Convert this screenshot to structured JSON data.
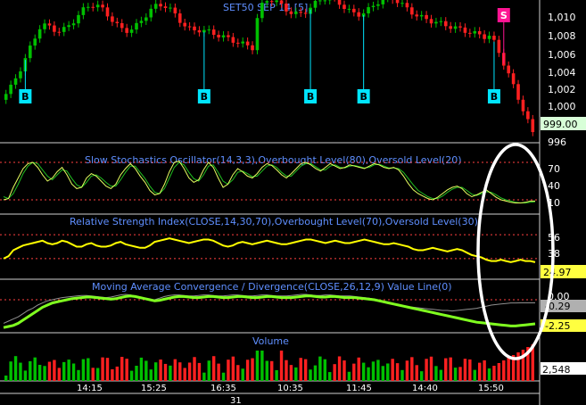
{
  "chart_data": [
    {
      "type": "candlestick",
      "title": "SET50 SEP 14 [5]",
      "y_ticks": [
        "1,010",
        "1,008",
        "1,006",
        "1,004",
        "1,002",
        "1,000"
      ],
      "ylim": [
        999,
        1011
      ],
      "current_value": "999.00",
      "bottom_label": "996",
      "signals": [
        {
          "type": "B",
          "x_index": 4
        },
        {
          "type": "B",
          "x_index": 41
        },
        {
          "type": "B",
          "x_index": 63
        },
        {
          "type": "B",
          "x_index": 74
        },
        {
          "type": "B",
          "x_index": 101
        },
        {
          "type": "S",
          "x_index": 103
        }
      ],
      "colors": {
        "up": "#00c000",
        "down": "#ff2020",
        "buy": "#00e5ff",
        "sell": "#ff1493"
      }
    },
    {
      "type": "line",
      "title": "Slow Stochastics Oscillator(14,3,3),Overbought Level(80),Oversold Level(20)",
      "y_ticks": [
        "70",
        "40",
        "10"
      ],
      "ylim": [
        0,
        100
      ],
      "levels": [
        80,
        20
      ],
      "series": [
        {
          "color": "#e8ff60",
          "values": [
            20,
            22,
            40,
            55,
            70,
            78,
            80,
            72,
            60,
            50,
            55,
            65,
            72,
            60,
            45,
            38,
            40,
            55,
            62,
            58,
            50,
            42,
            38,
            45,
            60,
            70,
            78,
            70,
            58,
            48,
            35,
            28,
            30,
            45,
            65,
            80,
            82,
            70,
            55,
            48,
            52,
            68,
            80,
            72,
            55,
            40,
            45,
            60,
            70,
            65,
            58,
            55,
            62,
            72,
            78,
            75,
            68,
            60,
            55,
            62,
            70,
            78,
            80,
            76,
            70,
            66,
            72,
            78,
            74,
            70,
            72,
            76,
            74,
            72,
            70,
            74,
            78,
            76,
            72,
            70,
            72,
            68,
            58,
            46,
            36,
            30,
            26,
            22,
            20,
            24,
            30,
            36,
            40,
            42,
            38,
            30,
            25,
            28,
            32,
            36,
            30,
            24,
            20,
            18,
            16,
            15,
            15,
            16,
            18,
            18
          ]
        },
        {
          "color": "#20c020",
          "values": [
            25,
            22,
            30,
            45,
            62,
            74,
            80,
            78,
            68,
            58,
            52,
            60,
            68,
            66,
            54,
            44,
            40,
            48,
            58,
            60,
            55,
            48,
            42,
            42,
            52,
            64,
            74,
            74,
            64,
            54,
            42,
            32,
            30,
            38,
            55,
            72,
            80,
            76,
            64,
            54,
            50,
            60,
            74,
            76,
            64,
            50,
            45,
            52,
            64,
            66,
            62,
            57,
            58,
            66,
            74,
            76,
            72,
            64,
            58,
            58,
            66,
            74,
            78,
            78,
            73,
            68,
            68,
            74,
            76,
            72,
            71,
            74,
            75,
            73,
            71,
            72,
            76,
            77,
            74,
            71,
            71,
            70,
            64,
            54,
            44,
            35,
            30,
            25,
            22,
            22,
            26,
            32,
            37,
            40,
            40,
            35,
            29,
            27,
            30,
            33,
            32,
            28,
            23,
            20,
            18,
            16,
            15,
            15,
            16,
            17
          ]
        }
      ]
    },
    {
      "type": "line",
      "title": "Relative Strength Index(CLOSE,14,30,70),Overbought Level(70),Oversold Level(30)",
      "y_ticks": [
        "56",
        "38"
      ],
      "ylim": [
        0,
        100
      ],
      "levels": [
        70,
        30
      ],
      "current_value": "24.97",
      "series": [
        {
          "color": "#ffff00",
          "values": [
            30,
            34,
            44,
            48,
            52,
            54,
            56,
            58,
            60,
            56,
            54,
            56,
            60,
            58,
            54,
            50,
            50,
            54,
            56,
            52,
            50,
            50,
            52,
            56,
            58,
            54,
            52,
            50,
            48,
            48,
            52,
            58,
            60,
            62,
            64,
            62,
            60,
            58,
            56,
            58,
            60,
            62,
            62,
            60,
            56,
            52,
            50,
            52,
            56,
            58,
            56,
            54,
            56,
            58,
            60,
            58,
            56,
            54,
            54,
            56,
            58,
            60,
            62,
            62,
            60,
            58,
            56,
            58,
            60,
            58,
            56,
            56,
            58,
            60,
            62,
            60,
            58,
            56,
            54,
            54,
            56,
            54,
            52,
            50,
            46,
            44,
            44,
            46,
            48,
            46,
            44,
            42,
            44,
            46,
            44,
            40,
            36,
            34,
            32,
            28,
            26,
            26,
            28,
            26,
            24,
            26,
            28,
            26,
            26,
            24
          ]
        }
      ]
    },
    {
      "type": "line",
      "title": "Moving Average Convergence / Divergence(CLOSE,26,12,9) Value Line(0)",
      "y_ticks": [
        "0.00"
      ],
      "ylim": [
        -3,
        1.5
      ],
      "levels": [
        0
      ],
      "value_boxes": [
        "-0.29",
        "-2.25"
      ],
      "series": [
        {
          "color": "#80ff20",
          "values": [
            -2.6,
            -2.5,
            -2.4,
            -2.2,
            -1.9,
            -1.6,
            -1.3,
            -1.0,
            -0.7,
            -0.5,
            -0.3,
            -0.2,
            -0.1,
            0.0,
            0.1,
            0.15,
            0.2,
            0.25,
            0.25,
            0.2,
            0.15,
            0.1,
            0.05,
            0.1,
            0.2,
            0.3,
            0.35,
            0.3,
            0.2,
            0.1,
            0.0,
            -0.1,
            -0.05,
            0.05,
            0.15,
            0.25,
            0.3,
            0.3,
            0.25,
            0.2,
            0.2,
            0.25,
            0.3,
            0.3,
            0.25,
            0.2,
            0.2,
            0.25,
            0.3,
            0.3,
            0.25,
            0.2,
            0.2,
            0.25,
            0.3,
            0.3,
            0.25,
            0.2,
            0.2,
            0.2,
            0.25,
            0.3,
            0.35,
            0.35,
            0.3,
            0.25,
            0.25,
            0.3,
            0.3,
            0.25,
            0.2,
            0.2,
            0.2,
            0.15,
            0.1,
            0.05,
            0.0,
            -0.1,
            -0.2,
            -0.3,
            -0.4,
            -0.5,
            -0.6,
            -0.7,
            -0.8,
            -0.9,
            -1.0,
            -1.1,
            -1.2,
            -1.3,
            -1.4,
            -1.5,
            -1.6,
            -1.7,
            -1.8,
            -1.9,
            -2.0,
            -2.1,
            -2.15,
            -2.2,
            -2.25,
            -2.3,
            -2.35,
            -2.4,
            -2.45,
            -2.45,
            -2.4,
            -2.35,
            -2.3,
            -2.25
          ]
        },
        {
          "color": "#909090",
          "values": [
            -2.2,
            -2.0,
            -1.8,
            -1.6,
            -1.3,
            -1.0,
            -0.8,
            -0.5,
            -0.3,
            -0.1,
            0.0,
            0.1,
            0.2,
            0.25,
            0.3,
            0.35,
            0.4,
            0.4,
            0.35,
            0.3,
            0.25,
            0.2,
            0.25,
            0.35,
            0.45,
            0.5,
            0.45,
            0.35,
            0.2,
            0.05,
            -0.05,
            0.0,
            0.15,
            0.3,
            0.4,
            0.45,
            0.45,
            0.4,
            0.35,
            0.35,
            0.4,
            0.45,
            0.45,
            0.4,
            0.35,
            0.35,
            0.4,
            0.45,
            0.45,
            0.4,
            0.35,
            0.35,
            0.4,
            0.45,
            0.45,
            0.4,
            0.35,
            0.35,
            0.35,
            0.4,
            0.45,
            0.5,
            0.5,
            0.45,
            0.4,
            0.4,
            0.45,
            0.45,
            0.4,
            0.35,
            0.35,
            0.35,
            0.3,
            0.25,
            0.2,
            0.15,
            0.05,
            -0.05,
            -0.15,
            -0.25,
            -0.35,
            -0.45,
            -0.55,
            -0.65,
            -0.7,
            -0.75,
            -0.8,
            -0.85,
            -0.9,
            -0.95,
            -1.0,
            -1.0,
            -1.05,
            -1.0,
            -0.95,
            -0.9,
            -0.85,
            -0.8,
            -0.7,
            -0.6,
            -0.5,
            -0.45,
            -0.4,
            -0.35,
            -0.3,
            -0.3,
            -0.29,
            -0.29,
            -0.29,
            -0.29
          ]
        }
      ]
    },
    {
      "type": "bar",
      "title": "Volume",
      "current_value": "2,548",
      "x_ticks": [
        "14:15",
        "15:25",
        "16:35",
        "10:35",
        "11:45",
        "14:40",
        "15:50"
      ],
      "bottom_label": "31"
    }
  ]
}
